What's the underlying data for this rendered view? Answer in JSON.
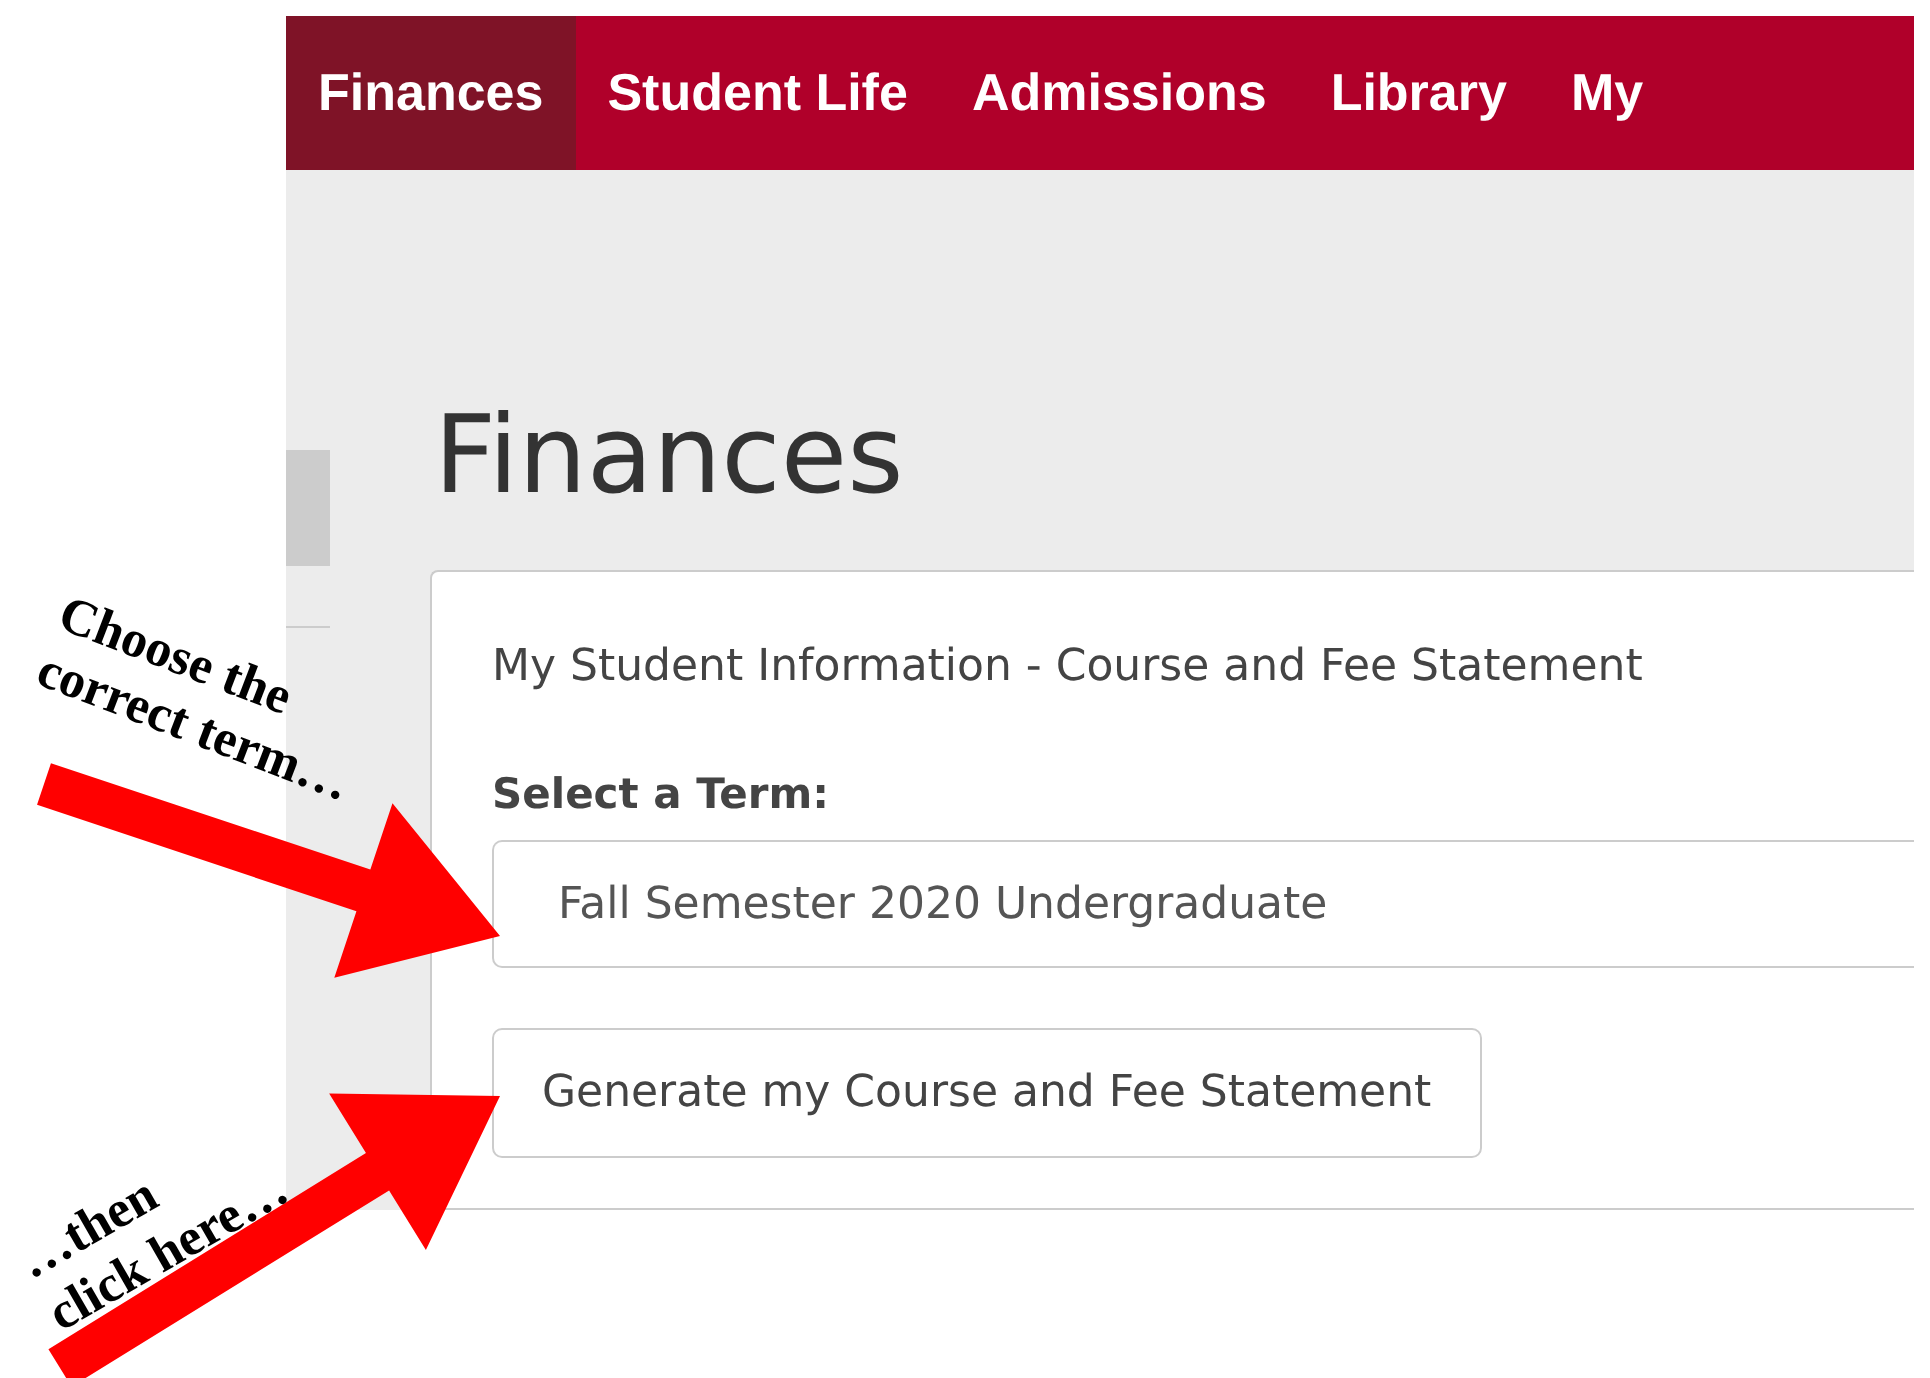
{
  "nav": [
    {
      "label": "Finances",
      "selected": true
    },
    {
      "label": "Student Life",
      "selected": false
    },
    {
      "label": "Admissions",
      "selected": false
    },
    {
      "label": "Library",
      "selected": false
    },
    {
      "label": "My",
      "selected": false
    }
  ],
  "page_title": "Finances",
  "card": {
    "title": "My Student Information - Course and Fee Statement",
    "term_label": "Select a Term:",
    "term_value": "Fall Semester 2020 Undergraduate",
    "button": "Generate my Course and Fee Statement"
  },
  "annotations": [
    {
      "lines": [
        "Choose the",
        "correct term…"
      ]
    },
    {
      "lines": [
        "…then",
        "click here…"
      ]
    }
  ]
}
